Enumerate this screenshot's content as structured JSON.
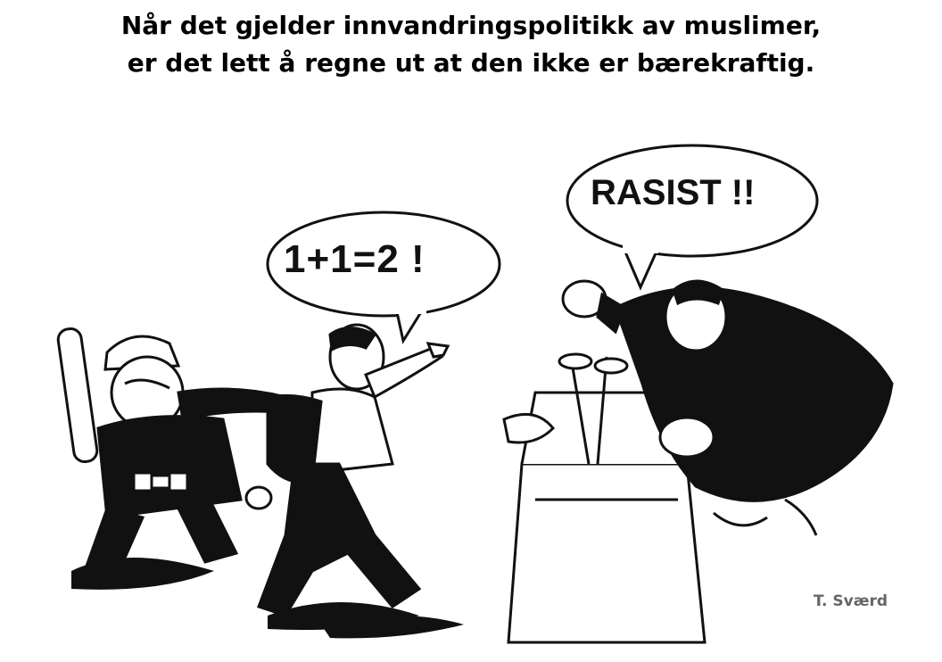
{
  "caption": {
    "line1": "Når det gjelder innvandringspolitikk av muslimer,",
    "line2": "er det lett å regne ut at den ikke er bærekraftig."
  },
  "speech_bubbles": [
    {
      "speaker": "man",
      "text": "1+1=2 !"
    },
    {
      "speaker": "politician",
      "text": "RASIST !!"
    }
  ],
  "signature": "T. Sværd",
  "colors": {
    "ink": "#111111",
    "paper": "#ffffff"
  }
}
